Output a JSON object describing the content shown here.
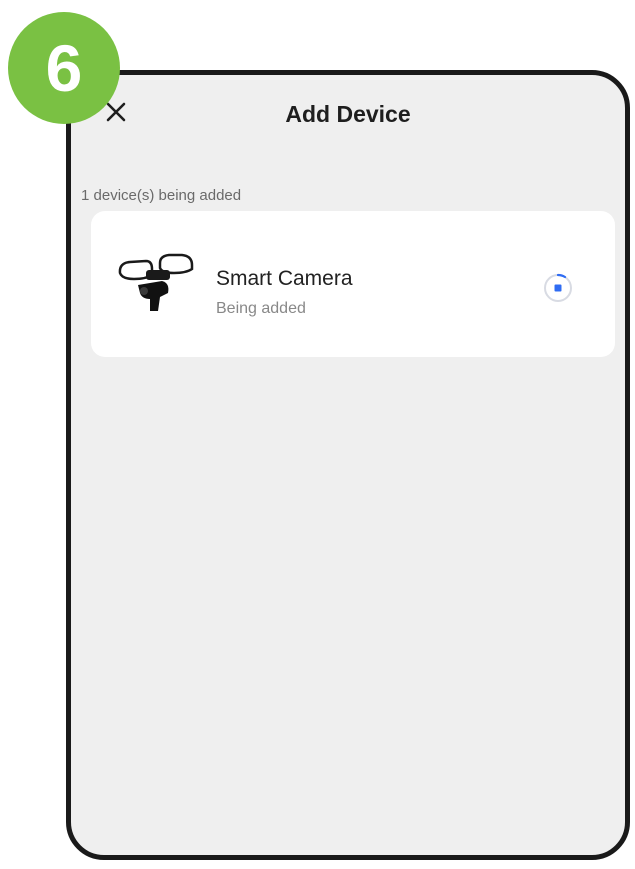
{
  "step_badge": "6",
  "header": {
    "title": "Add Device",
    "close_icon": "close-icon"
  },
  "subtitle": "1 device(s) being added",
  "device": {
    "name": "Smart Camera",
    "status": "Being added",
    "image_icon": "floodlight-camera-icon",
    "progress_icon": "loading-spinner-icon"
  },
  "colors": {
    "badge_green": "#7ac143",
    "background": "#efefef",
    "card": "#ffffff",
    "spinner_blue": "#2f6cf3"
  }
}
